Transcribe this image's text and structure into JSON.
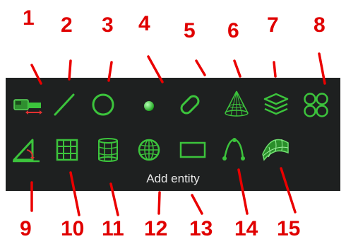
{
  "tooltip": "Add entity",
  "colors": {
    "panel": "#1e2020",
    "icon": "#3cc43c",
    "callout": "#e00000"
  },
  "tools": [
    {
      "name": "ruler-icon"
    },
    {
      "name": "line-icon"
    },
    {
      "name": "circle-icon"
    },
    {
      "name": "point-icon"
    },
    {
      "name": "rounded-shape-icon"
    },
    {
      "name": "cone-icon"
    },
    {
      "name": "layers-icon"
    },
    {
      "name": "four-circles-icon"
    },
    {
      "name": "angle-icon"
    },
    {
      "name": "grid-plane-icon"
    },
    {
      "name": "cylinder-grid-icon"
    },
    {
      "name": "sphere-icon"
    },
    {
      "name": "rectangle-icon"
    },
    {
      "name": "curve-icon"
    },
    {
      "name": "surface-patch-icon"
    }
  ],
  "callouts": [
    "1",
    "2",
    "3",
    "4",
    "5",
    "6",
    "7",
    "8",
    "9",
    "10",
    "11",
    "12",
    "13",
    "14",
    "15"
  ]
}
